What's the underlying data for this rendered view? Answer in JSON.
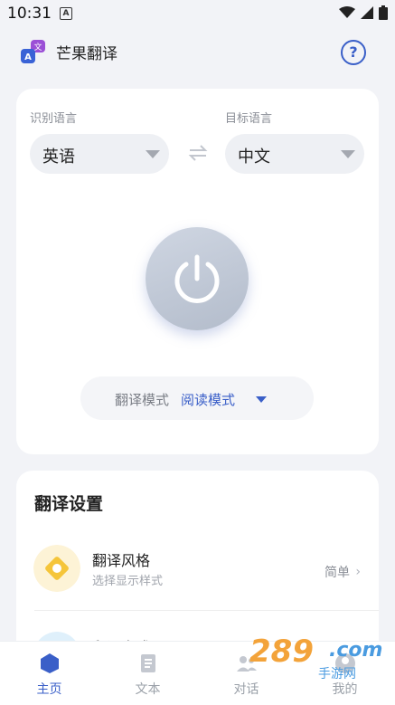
{
  "status": {
    "time": "10:31",
    "notif_letter": "A"
  },
  "app": {
    "title": "芒果翻译",
    "help_symbol": "?",
    "logo_letters": [
      "文",
      "A"
    ]
  },
  "language": {
    "source_label": "识别语言",
    "target_label": "目标语言",
    "source_value": "英语",
    "target_value": "中文"
  },
  "mode": {
    "label": "翻译模式",
    "value": "阅读模式"
  },
  "settings": {
    "title": "翻译设置",
    "items": [
      {
        "title": "翻译风格",
        "subtitle": "选择显示样式",
        "value": "简单"
      },
      {
        "title": "翻译方式",
        "subtitle": "",
        "value": ""
      }
    ]
  },
  "tabs": [
    {
      "label": "主页",
      "active": true
    },
    {
      "label": "文本",
      "active": false
    },
    {
      "label": "对话",
      "active": false
    },
    {
      "label": "我的",
      "active": false
    }
  ],
  "watermark": {
    "number": "289",
    "suffix": ".com",
    "site": "手游网"
  },
  "colors": {
    "accent": "#3a5fc8",
    "background": "#f2f3f7",
    "power_button": "#c3cad7",
    "style_icon": "#f5c53a"
  }
}
